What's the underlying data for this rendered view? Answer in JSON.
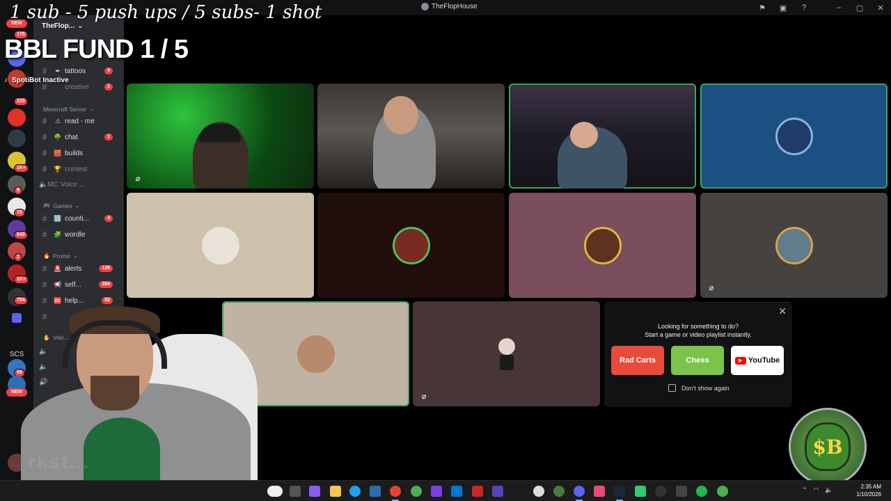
{
  "window": {
    "title": "TheFlopHouse"
  },
  "overlay": {
    "challenge_text": "1 sub - 5 push ups / 5 subs- 1 shot",
    "fund_text": "BBL FUND  1 / 5",
    "spotibot": "SpotiBot Inactive",
    "watermark": "rkst..."
  },
  "server_rail": {
    "badges": [
      "175",
      "133",
      "1K+",
      "9",
      "15",
      "540",
      "2",
      "1K+",
      "754",
      "69",
      "2"
    ],
    "new_label": "NEW",
    "scs_label": "SCS"
  },
  "channels": {
    "server_name": "TheFlop...",
    "items": [
      {
        "label": "tattoos",
        "count": "4",
        "emoji": "✒"
      },
      {
        "label": "creative",
        "count": "1",
        "muted": true
      }
    ],
    "categories": {
      "minecraft": "Minecraft Server",
      "games": "Games",
      "promo": "Promo",
      "voice": "Voic..."
    },
    "minecraft_items": [
      {
        "label": "read - me",
        "count": "",
        "emoji": "⚠"
      },
      {
        "label": "chat",
        "count": "1",
        "emoji": "🌳"
      },
      {
        "label": "builds",
        "count": "",
        "emoji": "🧱"
      },
      {
        "label": "contest",
        "count": "",
        "emoji": "🏆"
      }
    ],
    "mc_voice": "MC Voice ...",
    "games_items": [
      {
        "label": "counti...",
        "count": "4",
        "emoji": "🔢"
      },
      {
        "label": "wordle",
        "count": "",
        "emoji": "🧩"
      }
    ],
    "promo_items": [
      {
        "label": "alerts",
        "count": "129",
        "emoji": "🚨"
      },
      {
        "label": "self...",
        "count": "284",
        "emoji": "📢"
      },
      {
        "label": "help...",
        "count": "52",
        "emoji": "🆘"
      }
    ]
  },
  "activity_panel": {
    "heading_1": "Looking for something to do?",
    "heading_2": "Start a game or video playlist instantly.",
    "cards": [
      "Rad Carts",
      "Chess",
      "YouTube"
    ],
    "dont_show": "Don't show again"
  },
  "taskbar": {
    "time": "2:35 AM",
    "date": "1/10/2026"
  },
  "colors": {
    "accent_speaking": "#3ba55d",
    "badge_red": "#f23f43",
    "tile_blue": "#1b5082",
    "tile_beige": "#cdc1ac",
    "tile_maroon": "#200f0c",
    "tile_rose": "#7a4e5c",
    "tile_slate": "#454240",
    "tile_tan": "#c0b3a3",
    "tile_plum": "#473537"
  }
}
